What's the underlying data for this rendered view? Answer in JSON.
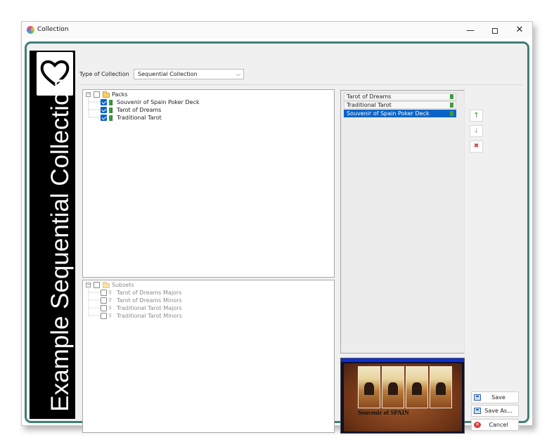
{
  "window": {
    "title": "Collection"
  },
  "banner": {
    "text": "Example Sequential Collection"
  },
  "collection_type": {
    "label": "Type of Collection",
    "selected": "Sequential Collection"
  },
  "packs_tree": {
    "root": "Packs",
    "items": [
      {
        "label": "Souvenir of Spain Poker Deck",
        "checked": true
      },
      {
        "label": "Tarot of Dreams",
        "checked": true
      },
      {
        "label": "Traditional Tarot",
        "checked": true
      }
    ]
  },
  "subsets_tree": {
    "root": "Subsets",
    "items": [
      {
        "label": "Tarot of Dreams Majors",
        "checked": false
      },
      {
        "label": "Tarot of Dreams Minors",
        "checked": false
      },
      {
        "label": "Traditional Tarot Majors",
        "checked": false
      },
      {
        "label": "Traditional Tarot Minors",
        "checked": false
      }
    ]
  },
  "order_list": {
    "items": [
      "Tarot of Dreams",
      "Traditional Tarot",
      "Souvenir of Spain Poker Deck"
    ],
    "selected_index": 2
  },
  "order_buttons": {
    "up": "↑",
    "down": "↓",
    "remove": "✖"
  },
  "preview": {
    "caption": "Souvenir of SPAIN"
  },
  "actions": {
    "save": "Save",
    "save_as": "Save As...",
    "cancel": "Cancel"
  },
  "colors": {
    "frame": "#3f7f78",
    "selection": "#0a64c8",
    "up_arrow": "#2e9e2e",
    "remove": "#d83a3a"
  }
}
